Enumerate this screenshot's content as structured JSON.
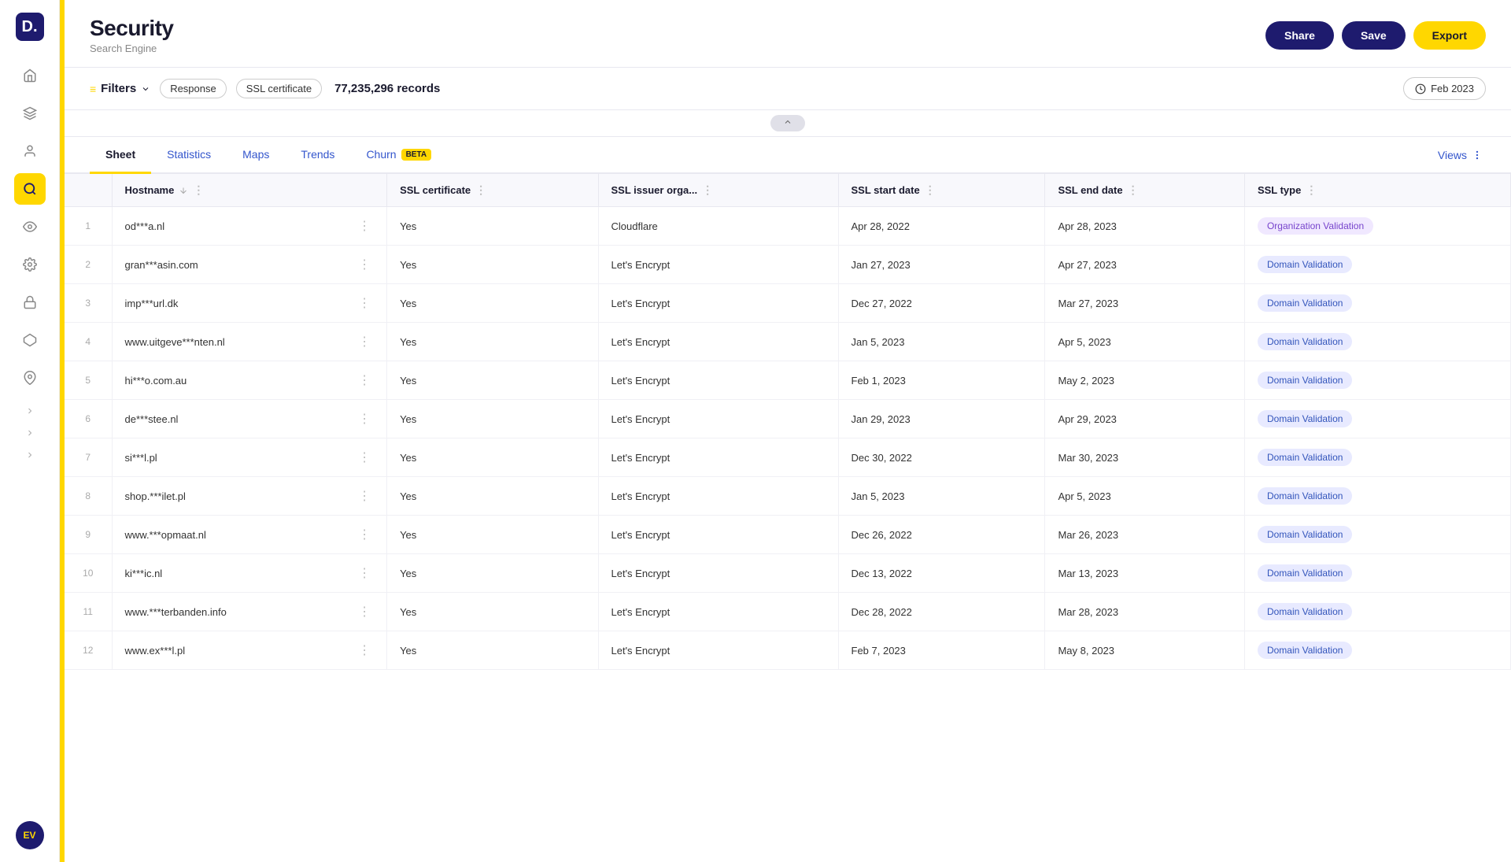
{
  "logo": {
    "text": "D."
  },
  "header": {
    "title": "Security",
    "subtitle": "Search Engine",
    "share_label": "Share",
    "save_label": "Save",
    "export_label": "Export"
  },
  "filters": {
    "label": "Filters",
    "tags": [
      "Response",
      "SSL certificate"
    ],
    "records_count": "77,235,296 records",
    "date_label": "Feb 2023"
  },
  "tabs": [
    {
      "id": "sheet",
      "label": "Sheet",
      "active": true
    },
    {
      "id": "statistics",
      "label": "Statistics",
      "active": false
    },
    {
      "id": "maps",
      "label": "Maps",
      "active": false
    },
    {
      "id": "trends",
      "label": "Trends",
      "active": false
    },
    {
      "id": "churn",
      "label": "Churn",
      "beta": true,
      "active": false
    }
  ],
  "views_label": "Views",
  "columns": [
    {
      "id": "hostname",
      "label": "Hostname"
    },
    {
      "id": "ssl_cert",
      "label": "SSL certificate"
    },
    {
      "id": "ssl_issuer",
      "label": "SSL issuer orga..."
    },
    {
      "id": "ssl_start",
      "label": "SSL start date"
    },
    {
      "id": "ssl_end",
      "label": "SSL end date"
    },
    {
      "id": "ssl_type",
      "label": "SSL type"
    }
  ],
  "rows": [
    {
      "num": 1,
      "hostname": "od***a.nl",
      "ssl_cert": "Yes",
      "ssl_issuer": "Cloudflare",
      "ssl_start": "Apr 28, 2022",
      "ssl_end": "Apr 28, 2023",
      "ssl_type": "Organization Validation",
      "type_class": "badge-org"
    },
    {
      "num": 2,
      "hostname": "gran***asin.com",
      "ssl_cert": "Yes",
      "ssl_issuer": "Let's Encrypt",
      "ssl_start": "Jan 27, 2023",
      "ssl_end": "Apr 27, 2023",
      "ssl_type": "Domain Validation",
      "type_class": "badge-domain"
    },
    {
      "num": 3,
      "hostname": "imp***url.dk",
      "ssl_cert": "Yes",
      "ssl_issuer": "Let's Encrypt",
      "ssl_start": "Dec 27, 2022",
      "ssl_end": "Mar 27, 2023",
      "ssl_type": "Domain Validation",
      "type_class": "badge-domain"
    },
    {
      "num": 4,
      "hostname": "www.uitgeve***nten.nl",
      "ssl_cert": "Yes",
      "ssl_issuer": "Let's Encrypt",
      "ssl_start": "Jan 5, 2023",
      "ssl_end": "Apr 5, 2023",
      "ssl_type": "Domain Validation",
      "type_class": "badge-domain"
    },
    {
      "num": 5,
      "hostname": "hi***o.com.au",
      "ssl_cert": "Yes",
      "ssl_issuer": "Let's Encrypt",
      "ssl_start": "Feb 1, 2023",
      "ssl_end": "May 2, 2023",
      "ssl_type": "Domain Validation",
      "type_class": "badge-domain"
    },
    {
      "num": 6,
      "hostname": "de***stee.nl",
      "ssl_cert": "Yes",
      "ssl_issuer": "Let's Encrypt",
      "ssl_start": "Jan 29, 2023",
      "ssl_end": "Apr 29, 2023",
      "ssl_type": "Domain Validation",
      "type_class": "badge-domain"
    },
    {
      "num": 7,
      "hostname": "si***l.pl",
      "ssl_cert": "Yes",
      "ssl_issuer": "Let's Encrypt",
      "ssl_start": "Dec 30, 2022",
      "ssl_end": "Mar 30, 2023",
      "ssl_type": "Domain Validation",
      "type_class": "badge-domain"
    },
    {
      "num": 8,
      "hostname": "shop.***ilet.pl",
      "ssl_cert": "Yes",
      "ssl_issuer": "Let's Encrypt",
      "ssl_start": "Jan 5, 2023",
      "ssl_end": "Apr 5, 2023",
      "ssl_type": "Domain Validation",
      "type_class": "badge-domain"
    },
    {
      "num": 9,
      "hostname": "www.***opmaat.nl",
      "ssl_cert": "Yes",
      "ssl_issuer": "Let's Encrypt",
      "ssl_start": "Dec 26, 2022",
      "ssl_end": "Mar 26, 2023",
      "ssl_type": "Domain Validation",
      "type_class": "badge-domain"
    },
    {
      "num": 10,
      "hostname": "ki***ic.nl",
      "ssl_cert": "Yes",
      "ssl_issuer": "Let's Encrypt",
      "ssl_start": "Dec 13, 2022",
      "ssl_end": "Mar 13, 2023",
      "ssl_type": "Domain Validation",
      "type_class": "badge-domain"
    },
    {
      "num": 11,
      "hostname": "www.***terbanden.info",
      "ssl_cert": "Yes",
      "ssl_issuer": "Let's Encrypt",
      "ssl_start": "Dec 28, 2022",
      "ssl_end": "Mar 28, 2023",
      "ssl_type": "Domain Validation",
      "type_class": "badge-domain"
    },
    {
      "num": 12,
      "hostname": "www.ex***l.pl",
      "ssl_cert": "Yes",
      "ssl_issuer": "Let's Encrypt",
      "ssl_start": "Feb 7, 2023",
      "ssl_end": "May 8, 2023",
      "ssl_type": "Domain Validation",
      "type_class": "badge-domain"
    }
  ],
  "sidebar_icons": {
    "home": "⌂",
    "layers": "⊞",
    "person": "👤",
    "search": "🔍",
    "eye": "👁",
    "settings": "⚙",
    "lock": "🔒",
    "diamond": "◈",
    "pin": "📌",
    "expand1": "›",
    "expand2": "›",
    "expand3": "›"
  },
  "user_avatar": "EV",
  "collapse_icon": "›",
  "beta_label": "BETA"
}
